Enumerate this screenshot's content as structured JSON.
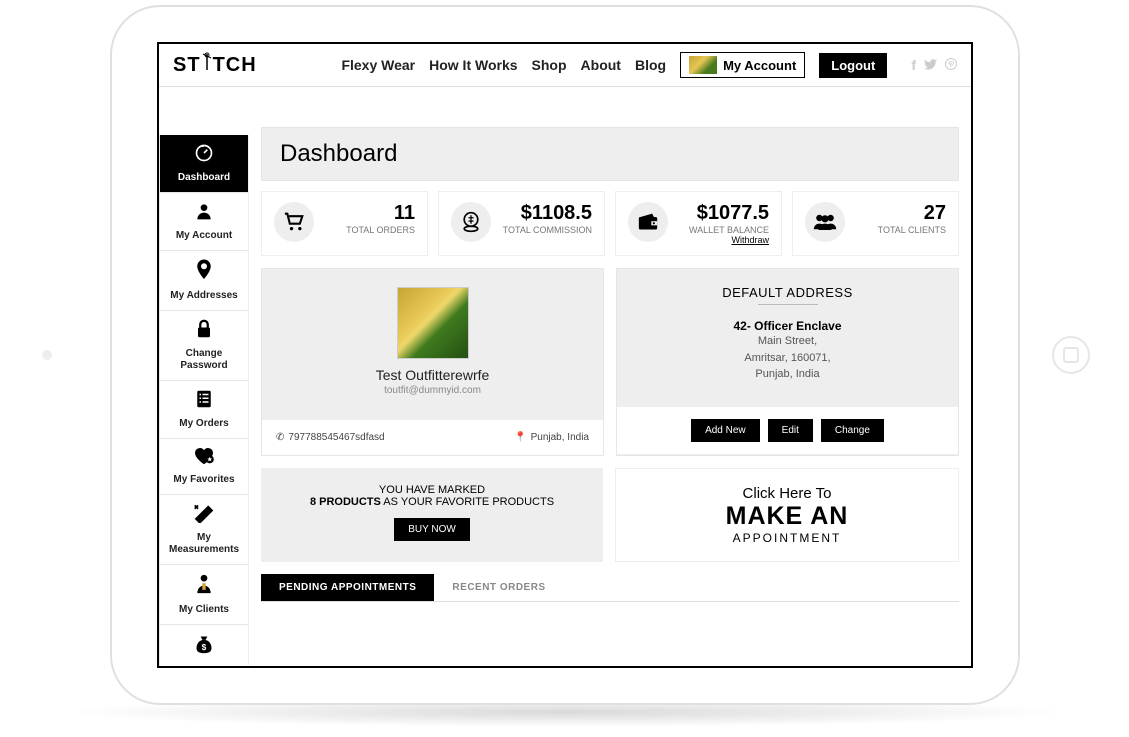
{
  "brand": "STITCH",
  "nav": {
    "flexy": "Flexy Wear",
    "how": "How It Works",
    "shop": "Shop",
    "about": "About",
    "blog": "Blog",
    "account": "My Account",
    "logout": "Logout"
  },
  "page_title": "Dashboard",
  "sidebar": [
    {
      "label": "Dashboard"
    },
    {
      "label": "My Account"
    },
    {
      "label": "My Addresses"
    },
    {
      "label": "Change Password"
    },
    {
      "label": "My Orders"
    },
    {
      "label": "My Favorites"
    },
    {
      "label": "My Measurements"
    },
    {
      "label": "My Clients"
    },
    {
      "label": ""
    }
  ],
  "stats": {
    "orders": {
      "value": "11",
      "label": "TOTAL ORDERS"
    },
    "commission": {
      "value": "$1108.5",
      "label": "TOTAL COMMISSION"
    },
    "wallet": {
      "value": "$1077.5",
      "label": "WALLET BALANCE",
      "withdraw": "Withdraw"
    },
    "clients": {
      "value": "27",
      "label": "TOTAL CLIENTS"
    }
  },
  "profile": {
    "name": "Test Outfitterewrfe",
    "email": "toutfit@dummyid.com",
    "phone": "797788545467sdfasd",
    "location": "Punjab, India"
  },
  "address": {
    "title": "DEFAULT ADDRESS",
    "line1": "42- Officer Enclave",
    "line2": "Main Street,",
    "line3": "Amritsar, 160071,",
    "line4": "Punjab, India",
    "btn_add": "Add New",
    "btn_edit": "Edit",
    "btn_change": "Change"
  },
  "favorites": {
    "line1": "YOU HAVE MARKED",
    "count": "8 PRODUCTS",
    "line2": " AS YOUR FAVORITE PRODUCTS",
    "buy": "BUY NOW"
  },
  "appointment": {
    "l1": "Click Here To",
    "l2": "MAKE AN",
    "l3": "APPOINTMENT"
  },
  "tabs": {
    "pending": "PENDING APPOINTMENTS",
    "recent": "RECENT ORDERS"
  }
}
